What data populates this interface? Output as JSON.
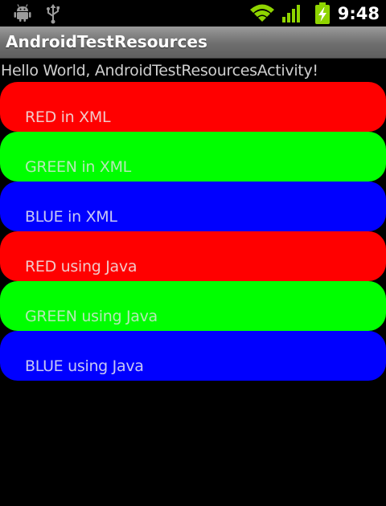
{
  "status_bar": {
    "time": "9:48",
    "icons": [
      "android-debug-icon",
      "usb-icon",
      "wifi-icon",
      "signal-icon",
      "battery-charging-icon"
    ]
  },
  "app": {
    "title": "AndroidTestResources"
  },
  "content": {
    "hello_text": "Hello World, AndroidTestResourcesActivity!"
  },
  "buttons": [
    {
      "label": "RED in XML",
      "color": "#ff0000",
      "text_color": "#f2c8c8"
    },
    {
      "label": "GREEN in XML",
      "color": "#00ff00",
      "text_color": "#b6e8b6"
    },
    {
      "label": "BLUE in XML",
      "color": "#0000ff",
      "text_color": "#c8c8f4"
    },
    {
      "label": "RED using Java",
      "color": "#ff0000",
      "text_color": "#f2c8c8"
    },
    {
      "label": "GREEN using Java",
      "color": "#00ff00",
      "text_color": "#b6e8b6"
    },
    {
      "label": "BLUE using Java",
      "color": "#0000ff",
      "text_color": "#c8c8f4"
    }
  ]
}
